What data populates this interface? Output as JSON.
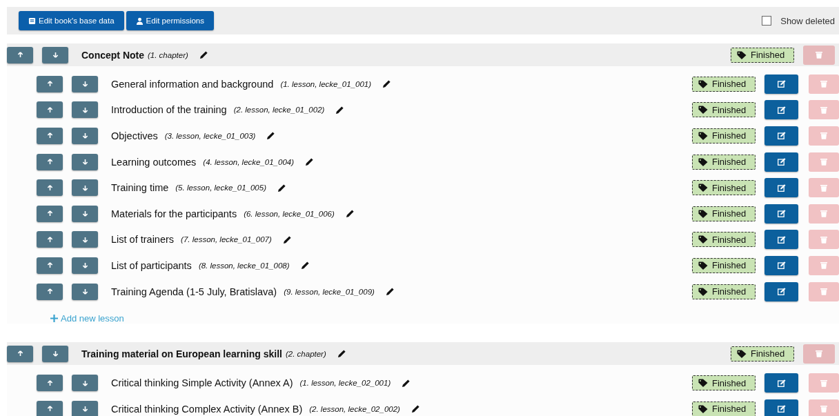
{
  "toolbar": {
    "buttons": [
      {
        "kind": "book",
        "label": "Edit book's base data"
      },
      {
        "kind": "user",
        "label": "Edit permissions"
      }
    ],
    "show_deleted": {
      "label": "Show deleted",
      "checked": false
    }
  },
  "chapters": [
    {
      "title": "Concept Note",
      "info": "(1. chapter)",
      "status": "Finished",
      "deletable": false,
      "lessons": [
        {
          "title": "General information and background",
          "info": "(1. lesson, lecke_01_001)",
          "status": "Finished",
          "deletable": false
        },
        {
          "title": "Introduction of the training",
          "info": "(2. lesson, lecke_01_002)",
          "status": "Finished",
          "deletable": false
        },
        {
          "title": "Objectives",
          "info": "(3. lesson, lecke_01_003)",
          "status": "Finished",
          "deletable": false
        },
        {
          "title": "Learning outcomes",
          "info": "(4. lesson, lecke_01_004)",
          "status": "Finished",
          "deletable": false
        },
        {
          "title": "Training time",
          "info": "(5. lesson, lecke_01_005)",
          "status": "Finished",
          "deletable": false
        },
        {
          "title": "Materials for the participants",
          "info": "(6. lesson, lecke_01_006)",
          "status": "Finished",
          "deletable": false
        },
        {
          "title": "List of trainers",
          "info": "(7. lesson, lecke_01_007)",
          "status": "Finished",
          "deletable": false
        },
        {
          "title": "List of participants",
          "info": "(8. lesson, lecke_01_008)",
          "status": "Finished",
          "deletable": false
        },
        {
          "title": "Training Agenda (1-5 July, Bratislava)",
          "info": "(9. lesson, lecke_01_009)",
          "status": "Finished",
          "deletable": false
        }
      ],
      "add_lesson": "Add new lesson"
    },
    {
      "title": "Training material on European learning skill",
      "info": "(2. chapter)",
      "status": "Finished",
      "deletable": false,
      "lessons": [
        {
          "title": "Critical thinking Simple Activity (Annex A)",
          "info": "(1. lesson, lecke_02_001)",
          "status": "Finished",
          "deletable": false
        },
        {
          "title": "Critical thinking Complex Activity (Annex B)",
          "info": "(2. lesson, lecke_02_002)",
          "status": "Finished",
          "deletable": false
        }
      ]
    }
  ]
}
